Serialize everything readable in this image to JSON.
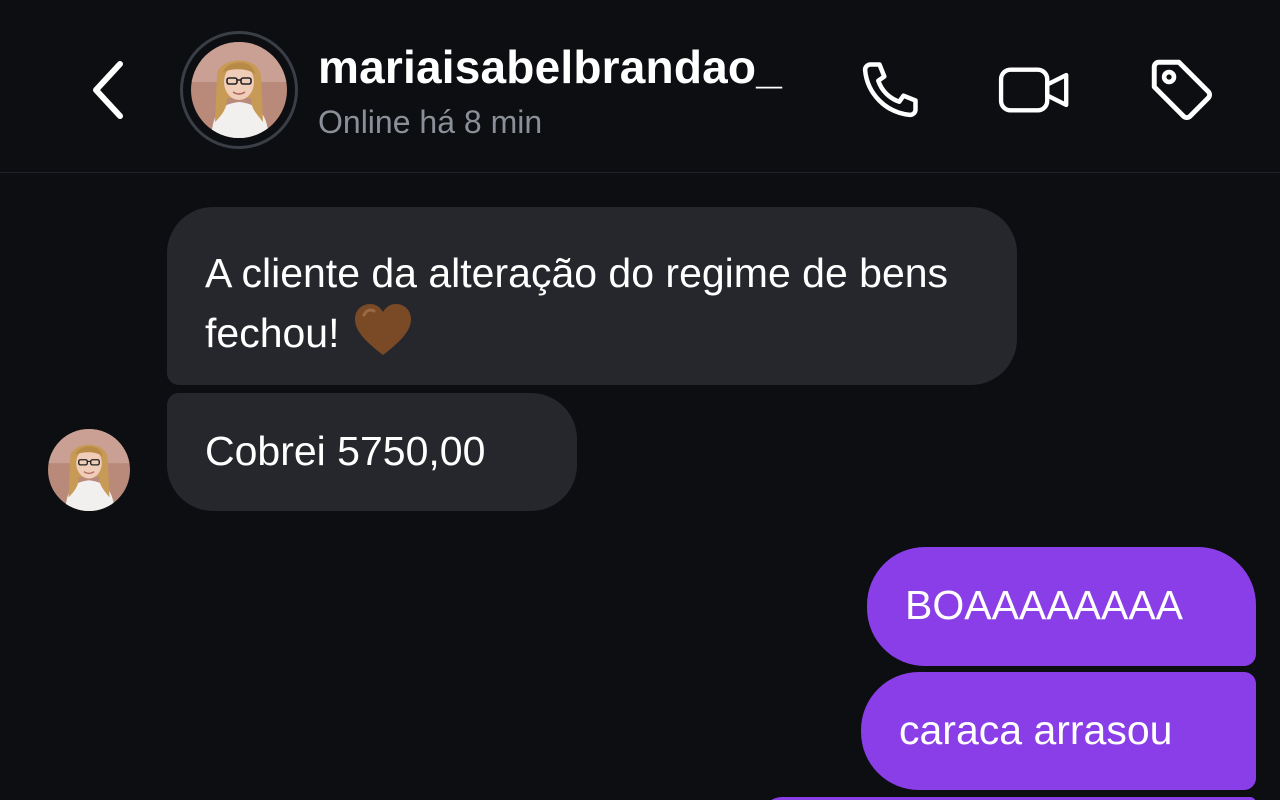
{
  "header": {
    "username": "mariaisabelbrandao_",
    "status": "Online há 8 min"
  },
  "icons": {
    "back": "chevron-left-icon",
    "call": "phone-icon",
    "video": "video-camera-icon",
    "tag": "tag-icon",
    "heart": "brown-heart-emoji"
  },
  "messages": [
    {
      "direction": "incoming",
      "text": "A cliente da alteração do regime de bens fechou!",
      "emoji": "🤎"
    },
    {
      "direction": "incoming",
      "text": "Cobrei 5750,00"
    },
    {
      "direction": "outgoing",
      "text": "BOAAAAAAAA"
    },
    {
      "direction": "outgoing",
      "text": "caraca arrasou"
    },
    {
      "direction": "outgoing",
      "text": ""
    }
  ],
  "colors": {
    "background": "#0c0e12",
    "incoming_bubble": "#26272c",
    "outgoing_bubble": "#8a3ee8",
    "status_text": "#8a8f98",
    "heart": "#7a4a26"
  }
}
